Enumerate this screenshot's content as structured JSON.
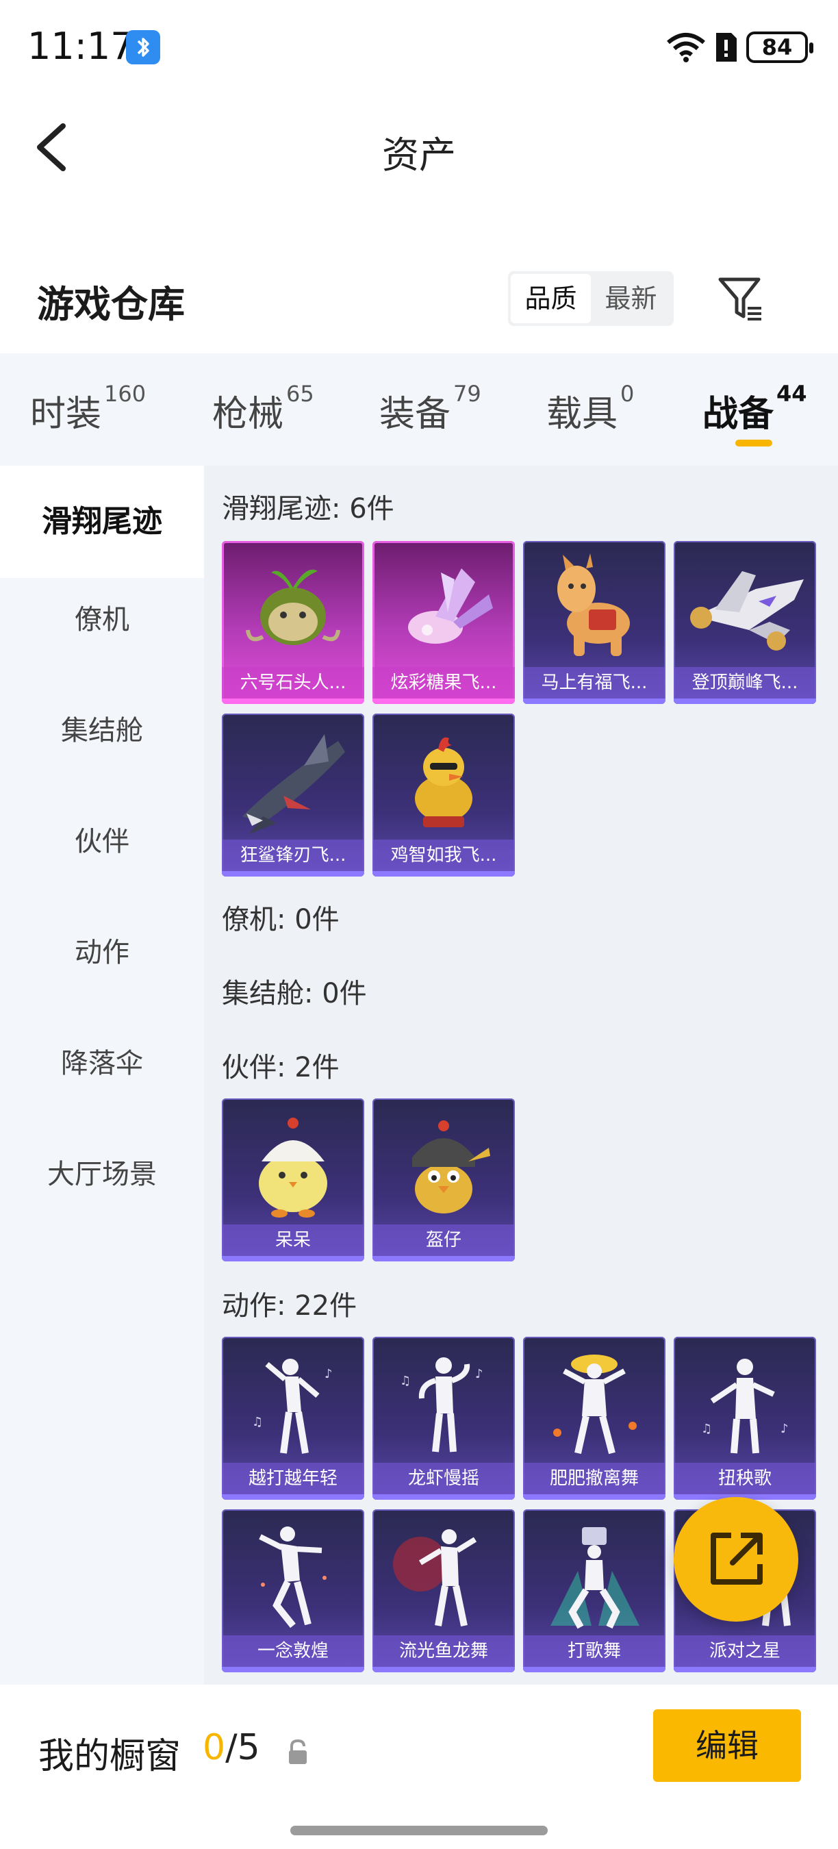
{
  "status_bar": {
    "time": "11:17",
    "battery": "84"
  },
  "header": {
    "title": "资产",
    "back_icon": "chevron-left-icon"
  },
  "warehouse": {
    "title": "游戏仓库",
    "sort_options": [
      "品质",
      "最新"
    ],
    "sort_selected": "品质",
    "filter_icon": "filter-icon"
  },
  "categories": [
    {
      "label": "时装",
      "count": "160"
    },
    {
      "label": "枪械",
      "count": "65"
    },
    {
      "label": "装备",
      "count": "79"
    },
    {
      "label": "载具",
      "count": "0"
    },
    {
      "label": "战备",
      "count": "44"
    }
  ],
  "active_category": "战备",
  "sidebar": {
    "items": [
      "滑翔尾迹",
      "僚机",
      "集结舱",
      "伙伴",
      "动作",
      "降落伞",
      "大厅场景"
    ],
    "active": "滑翔尾迹"
  },
  "sections": {
    "glide": {
      "title": "滑翔尾迹: 6件",
      "items": [
        "六号石头人...",
        "炫彩糖果飞...",
        "马上有福飞...",
        "登顶巅峰飞...",
        "狂鲨锋刃飞...",
        "鸡智如我飞..."
      ]
    },
    "wingman": {
      "title": "僚机: 0件"
    },
    "pod": {
      "title": "集结舱: 0件"
    },
    "partner": {
      "title": "伙伴: 2件",
      "items": [
        "呆呆",
        "盔仔"
      ]
    },
    "emote": {
      "title": "动作: 22件",
      "items": [
        "越打越年轻",
        "龙虾慢摇",
        "肥肥撤离舞",
        "扭秧歌",
        "一念敦煌",
        "流光鱼龙舞",
        "打歌舞",
        "派对之星"
      ]
    }
  },
  "showcase": {
    "title": "我的橱窗",
    "current": "0",
    "total": "/5",
    "edit_label": "编辑"
  },
  "colors": {
    "accent": "#f7b500",
    "card_purple": "#3c3078",
    "card_pink": "#b43cb8"
  }
}
